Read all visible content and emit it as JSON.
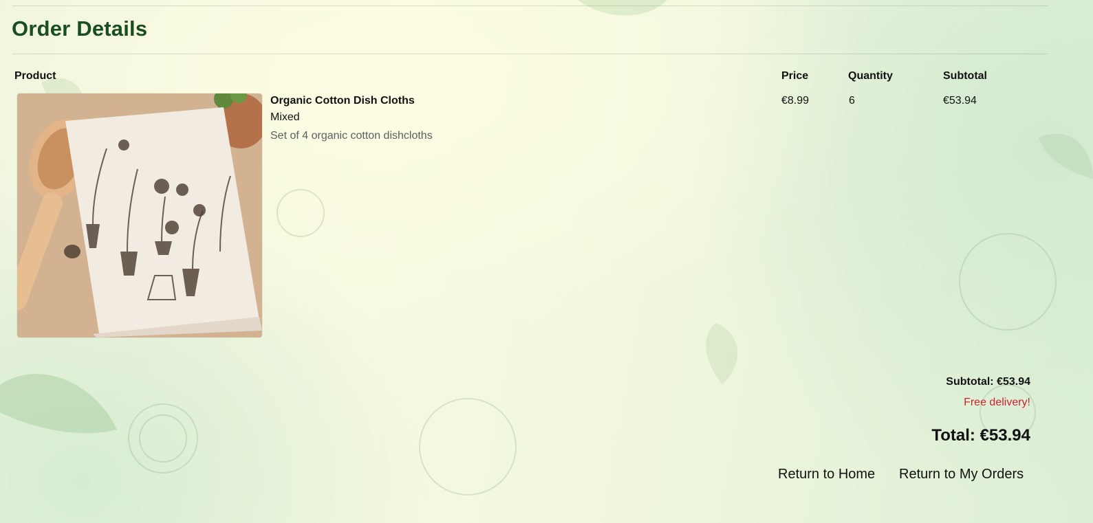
{
  "page": {
    "title": "Order Details"
  },
  "table": {
    "headers": {
      "product": "Product",
      "price": "Price",
      "quantity": "Quantity",
      "subtotal": "Subtotal"
    },
    "rows": [
      {
        "name": "Organic Cotton Dish Cloths",
        "variant": "Mixed",
        "description": "Set of 4 organic cotton dishcloths",
        "price": "€8.99",
        "quantity": "6",
        "subtotal": "€53.94",
        "image": "folded-cotton-cloth-with-botanical-print"
      }
    ]
  },
  "summary": {
    "subtotal": "Subtotal: €53.94",
    "delivery": "Free delivery!",
    "total": "Total: €53.94"
  },
  "actions": {
    "home": "Return to Home",
    "orders": "Return to My Orders"
  },
  "colors": {
    "title": "#1a4d1f",
    "delivery": "#d0232d"
  }
}
